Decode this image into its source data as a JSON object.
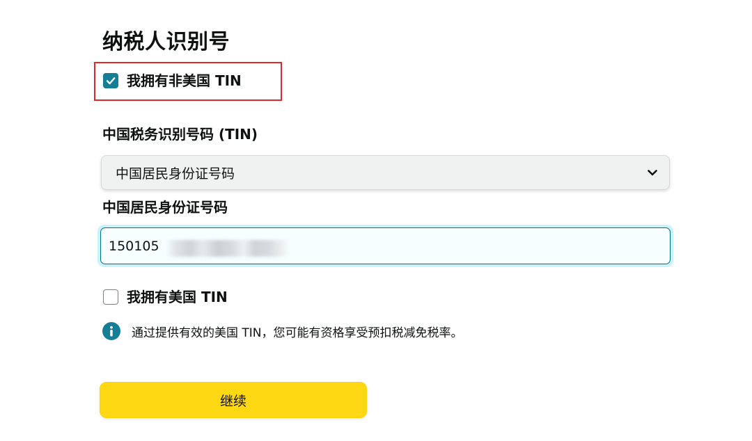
{
  "section": {
    "title": "纳税人识别号"
  },
  "non_us_tin": {
    "label": "我拥有非美国 TIN",
    "checked": true
  },
  "tin_type": {
    "label": "中国税务识别号码 (TIN)",
    "selected": "中国居民身份证号码"
  },
  "id_number": {
    "label": "中国居民身份证号码",
    "value": "150105"
  },
  "us_tin": {
    "label": "我拥有美国 TIN",
    "checked": false
  },
  "info": {
    "text": "通过提供有效的美国 TIN，您可能有资格享受预扣税减免税率。"
  },
  "actions": {
    "continue_label": "继续"
  },
  "colors": {
    "checkbox_accent": "#167d97",
    "highlight_border": "#e0282b",
    "button_bg": "#ffd814",
    "input_focus_ring": "#c8f3fa",
    "info_icon": "#167d97"
  },
  "icons": {
    "checkbox_checked": "checkmark-icon",
    "select_arrow": "chevron-down-icon",
    "info": "info-icon"
  }
}
